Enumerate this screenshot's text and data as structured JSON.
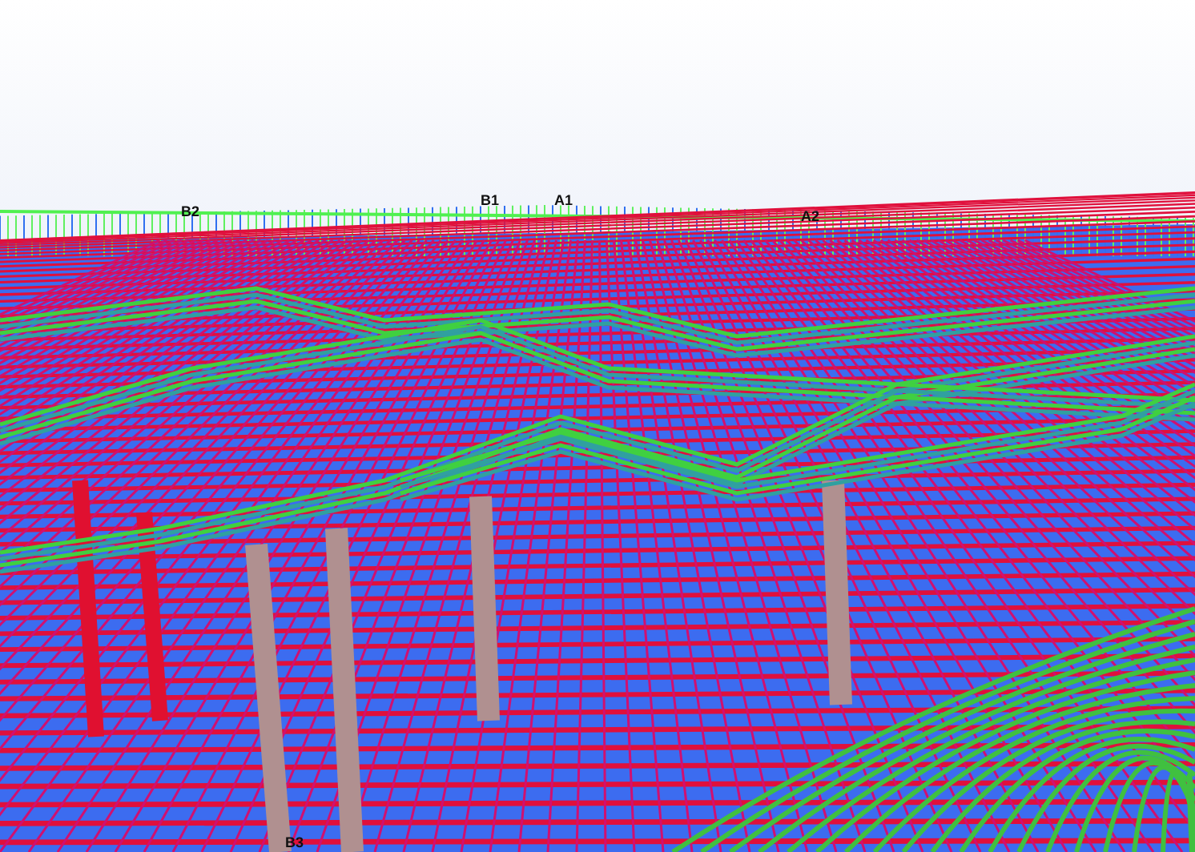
{
  "viewport": {
    "grid_labels": [
      {
        "text": "B2"
      },
      {
        "text": "B1"
      },
      {
        "text": "A1"
      },
      {
        "text": "A2"
      },
      {
        "text": "B3"
      }
    ]
  }
}
